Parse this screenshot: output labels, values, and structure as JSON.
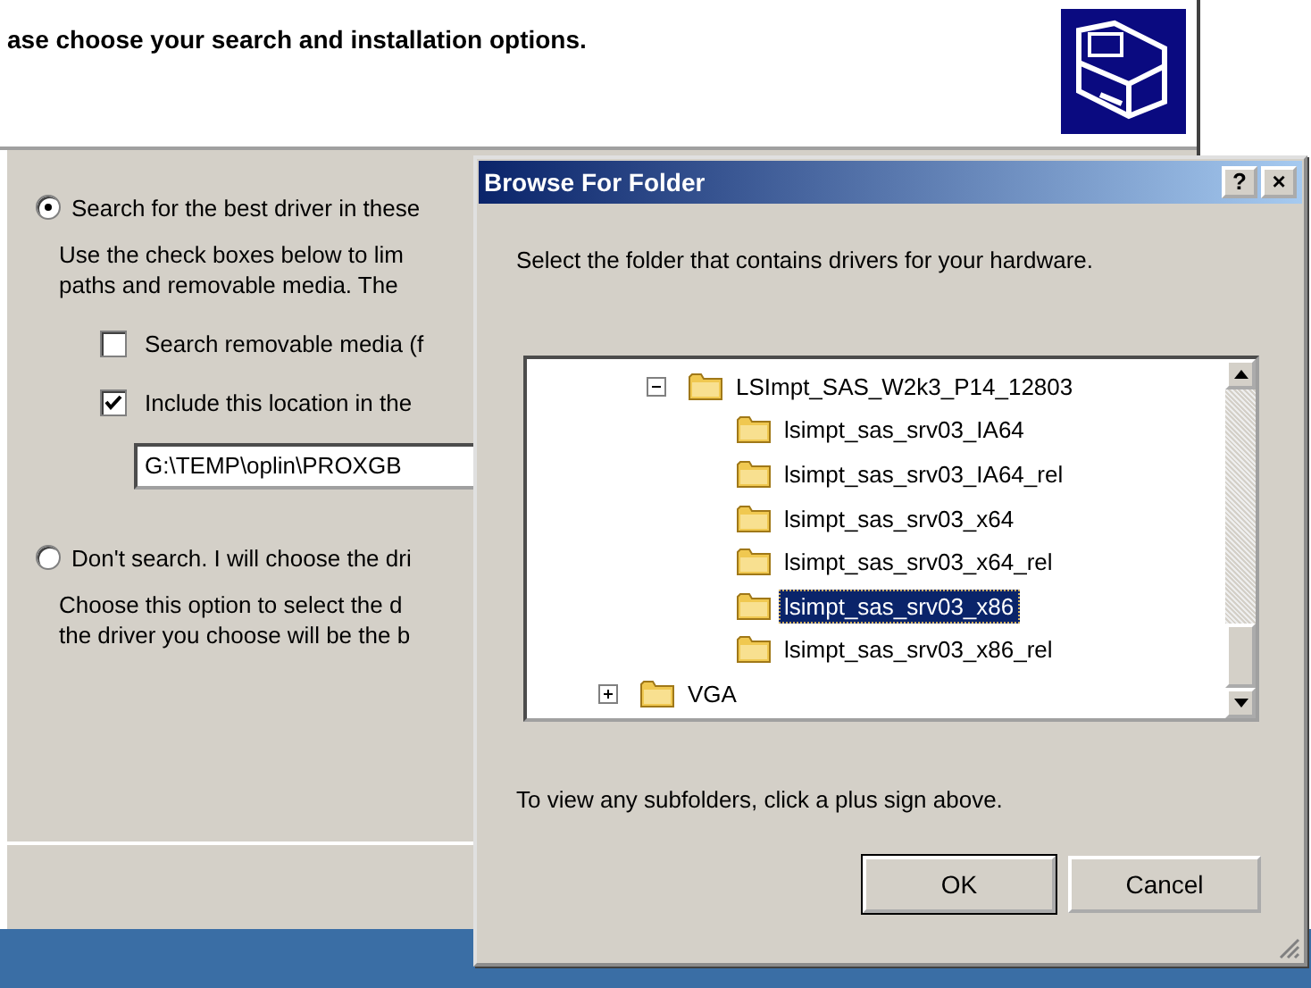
{
  "wizard": {
    "heading": "ase choose your search and installation options.",
    "options": [
      {
        "label": "Search for the best driver in these",
        "selected": true,
        "description": [
          "Use the check boxes below to lim",
          "paths and removable media. The"
        ]
      },
      {
        "label": "Don't search. I will choose the dri",
        "selected": false,
        "description": [
          "Choose this option to select the d",
          "the driver you choose will be the b"
        ]
      }
    ],
    "checkboxes": [
      {
        "label": "Search removable media (f",
        "checked": false
      },
      {
        "label": "Include this location in the",
        "checked": true
      }
    ],
    "path_field": {
      "value": "G:\\TEMP\\oplin\\PROXGB"
    }
  },
  "dialog": {
    "title": "Browse For Folder",
    "help_button": "?",
    "close_button": "×",
    "prompt": "Select the folder that contains drivers for your hardware.",
    "tree": {
      "items": [
        {
          "children": [
            {
              "label": "LSImpt_SAS_W2k3_P14_12803",
              "expanded": true,
              "selected": false,
              "children": [
                {
                  "label": "lsimpt_sas_srv03_IA64",
                  "selected": false
                },
                {
                  "label": "lsimpt_sas_srv03_IA64_rel",
                  "selected": false
                },
                {
                  "label": "lsimpt_sas_srv03_x64",
                  "selected": false
                },
                {
                  "label": "lsimpt_sas_srv03_x64_rel",
                  "selected": false
                },
                {
                  "label": "lsimpt_sas_srv03_x86",
                  "selected": true
                },
                {
                  "label": "lsimpt_sas_srv03_x86_rel",
                  "selected": false
                }
              ]
            }
          ]
        },
        {
          "label": "VGA",
          "expanded": false,
          "selected": false
        }
      ]
    },
    "hint": "To view any subfolders, click a plus sign above.",
    "buttons": [
      "OK",
      "Cancel"
    ]
  }
}
